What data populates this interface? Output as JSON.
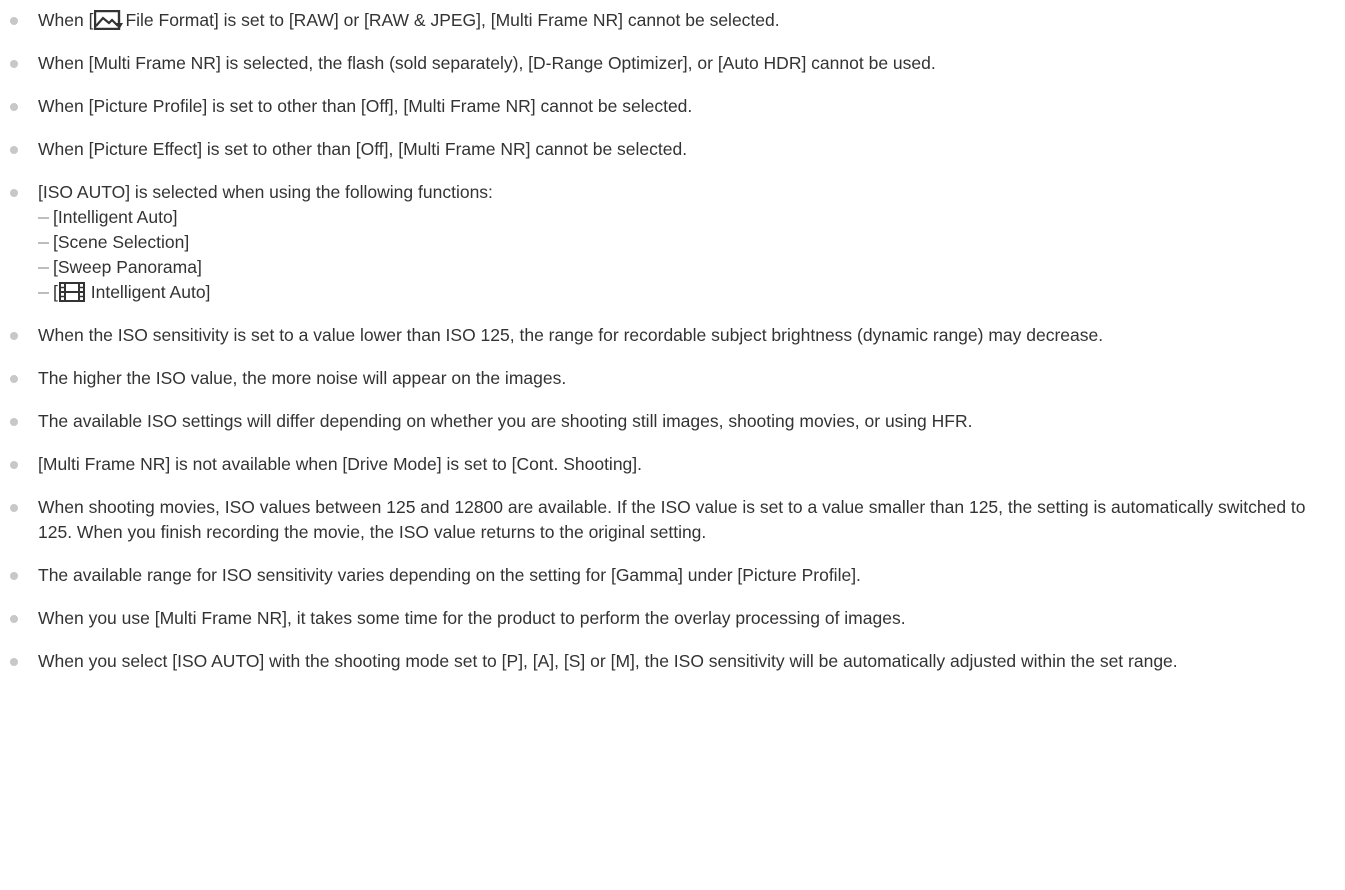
{
  "notes": [
    {
      "before": "When [",
      "icon": "still-image-icon",
      "after": "File Format] is set to [RAW] or [RAW & JPEG], [Multi Frame NR] cannot be selected."
    },
    {
      "text": "When [Multi Frame NR] is selected, the flash (sold separately), [D-Range Optimizer], or [Auto HDR] cannot be used."
    },
    {
      "text": "When [Picture Profile] is set to other than [Off], [Multi Frame NR] cannot be selected."
    },
    {
      "text": "When [Picture Effect] is set to other than [Off], [Multi Frame NR] cannot be selected."
    },
    {
      "text": "[ISO AUTO] is selected when using the following functions:",
      "subitems": [
        {
          "text": "[Intelligent Auto]"
        },
        {
          "text": "[Scene Selection]"
        },
        {
          "text": "[Sweep Panorama]"
        },
        {
          "before": "[",
          "icon": "movie-film-icon",
          "after": " Intelligent Auto]"
        }
      ]
    },
    {
      "text": "When the ISO sensitivity is set to a value lower than ISO 125, the range for recordable subject brightness (dynamic range) may decrease."
    },
    {
      "text": "The higher the ISO value, the more noise will appear on the images."
    },
    {
      "text": "The available ISO settings will differ depending on whether you are shooting still images, shooting movies, or using HFR."
    },
    {
      "text": "[Multi Frame NR] is not available when [Drive Mode] is set to [Cont. Shooting]."
    },
    {
      "text": "When shooting movies, ISO values between 125 and 12800 are available. If the ISO value is set to a value smaller than 125, the setting is automatically switched to 125. When you finish recording the movie, the ISO value returns to the original setting."
    },
    {
      "text": "The available range for ISO sensitivity varies depending on the setting for [Gamma] under [Picture Profile]."
    },
    {
      "text": "When you use [Multi Frame NR], it takes some time for the product to perform the overlay processing of images."
    },
    {
      "text": "When you select [ISO AUTO] with the shooting mode set to [P], [A], [S] or [M], the ISO sensitivity will be automatically adjusted within the set range."
    }
  ],
  "colors": {
    "text": "#333333",
    "bullet": "#c8c8c8",
    "dash": "#bdbdbd",
    "icon": "#333333"
  }
}
